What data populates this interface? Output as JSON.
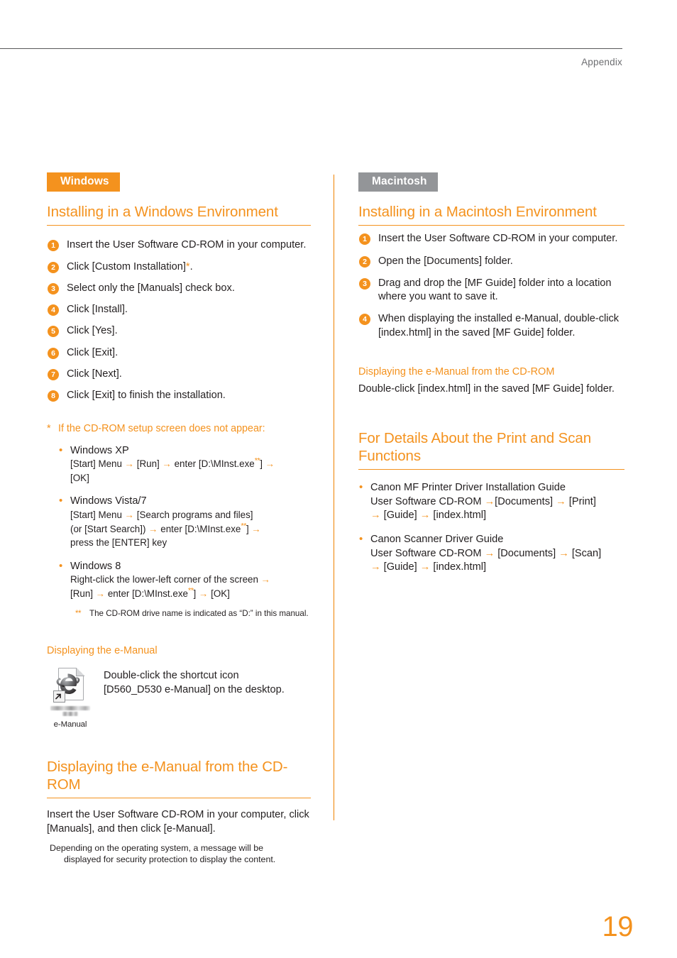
{
  "header": {
    "running_title": "Appendix"
  },
  "page_number": "19",
  "colors": {
    "accent_orange": "#F4921E",
    "divider_orange": "#EF8200",
    "macintosh_gray": "#939598",
    "body_text": "#231F20",
    "header_gray": "#6D6E71"
  },
  "left_column": {
    "badge": "Windows",
    "section_title": "Installing in a Windows Environment",
    "steps": [
      {
        "num": "1",
        "text": "Insert the User Software CD-ROM in your computer."
      },
      {
        "num": "2",
        "text": "Click [Custom Installation]",
        "suffix_marker": "*",
        "tail": "."
      },
      {
        "num": "3",
        "text": "Select only the [Manuals] check box."
      },
      {
        "num": "4",
        "text": "Click [Install]."
      },
      {
        "num": "5",
        "text": "Click [Yes]."
      },
      {
        "num": "6",
        "text": "Click [Exit]."
      },
      {
        "num": "7",
        "text": "Click [Next]."
      },
      {
        "num": "8",
        "text": "Click [Exit] to finish the installation."
      }
    ],
    "footnote_star": {
      "marker": "*",
      "text": "If the CD-ROM setup screen does not appear:"
    },
    "os_items": [
      {
        "os": "Windows XP",
        "line1_a": "[Start] Menu ",
        "arrow1": "→",
        "line1_b": " [Run] ",
        "arrow2": "→",
        "line1_c": " enter [D:\\MInst.exe",
        "dbl": "**",
        "line1_d": "] ",
        "arrow3": "→",
        "line2": "[OK]"
      },
      {
        "os": "Windows Vista/7",
        "line1_a": "[Start] Menu ",
        "arrow1": "→",
        "line1_b": " [Search programs and files]",
        "line2_a": "(or [Start Search]) ",
        "arrow2": "→",
        "line2_b": " enter [D:\\MInst.exe",
        "dbl": "**",
        "line2_c": "] ",
        "arrow3": "→",
        "line3": "press the [ENTER] key"
      },
      {
        "os": "Windows 8",
        "line1_a": "Right-click the lower-left corner of the screen ",
        "arrow1": "→",
        "line2_a": "[Run] ",
        "arrow2": "→",
        "line2_b": " enter [D:\\MInst.exe",
        "dbl": "**",
        "line2_c": "] ",
        "arrow3": "→",
        "line2_d": " [OK]"
      }
    ],
    "footnote_dbl": {
      "marker": "**",
      "text": "The CD-ROM drive name is indicated as “D:” in this manual."
    },
    "emanual_subhead": "Displaying the e-Manual",
    "emanual_icon": {
      "icon_caption": "e-Manual",
      "text_line1": "Double-click the shortcut icon",
      "text_line2": "[D560_D530 e-Manual] on the desktop."
    },
    "cdrom_section_title": "Displaying the e-Manual from the CD-ROM",
    "cdrom_body": "Insert the User Software CD-ROM in your computer, click [Manuals], and then click [e-Manual].",
    "cdrom_note_line1": "Depending on the operating system, a message will be",
    "cdrom_note_line2": "displayed for security protection to display the content."
  },
  "right_column": {
    "badge": "Macintosh",
    "section_title": "Installing in a Macintosh Environment",
    "steps": [
      {
        "num": "1",
        "text": "Insert the User Software CD-ROM in your computer."
      },
      {
        "num": "2",
        "text": "Open the [Documents] folder."
      },
      {
        "num": "3",
        "text": "Drag and drop the [MF Guide] folder into a location where you want to save it."
      },
      {
        "num": "4",
        "text": "When displaying the installed e-Manual, double-click [index.html] in the saved [MF Guide] folder."
      }
    ],
    "cdrom_subhead": "Displaying the e-Manual from the CD-ROM",
    "cdrom_body": "Double-click [index.html] in the saved [MF Guide] folder.",
    "details_title": "For Details About the Print and Scan Functions",
    "guides": [
      {
        "name": "Canon MF Printer Driver Installation Guide",
        "path_a": "User Software CD-ROM ",
        "arrow1": "→",
        "path_b": "[Documents] ",
        "arrow2": "→",
        "path_c": " [Print]",
        "arrow3": "→",
        "path_d": " [Guide] ",
        "arrow4": "→",
        "path_e": " [index.html]"
      },
      {
        "name": "Canon Scanner Driver Guide",
        "path_a": "User Software CD-ROM ",
        "arrow1": "→",
        "path_b": " [Documents] ",
        "arrow2": "→",
        "path_c": " [Scan]",
        "arrow3": "→",
        "path_d": " [Guide] ",
        "arrow4": "→",
        "path_e": " [index.html]"
      }
    ]
  }
}
